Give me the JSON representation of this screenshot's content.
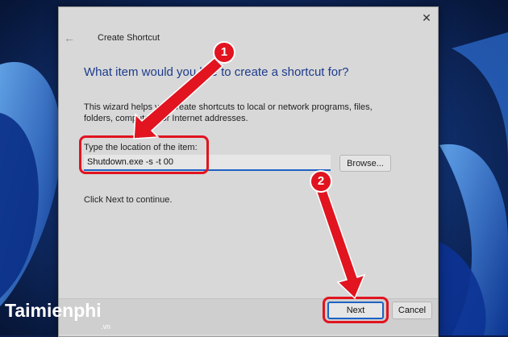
{
  "dialog": {
    "title": "Create Shortcut",
    "back_icon": "back-arrow-icon",
    "close_icon": "close-icon",
    "close_glyph": "✕",
    "back_glyph": "←",
    "heading": "What item would you like to create a shortcut for?",
    "description": "This wizard helps you create shortcuts to local or network programs, files, folders, computers, or Internet addresses.",
    "field_label": "Type the location of the item:",
    "location_value": "Shutdown.exe -s -t 00",
    "browse_label": "Browse...",
    "continue_text": "Click Next to continue.",
    "next_label": "Next",
    "cancel_label": "Cancel"
  },
  "annotations": {
    "badge_1": "1",
    "badge_2": "2",
    "highlight_color": "#e1141f"
  },
  "watermark": {
    "brand": "Taimienphi",
    "suffix": ".vn"
  },
  "colors": {
    "accent": "#1e62c4",
    "heading": "#1d3b8c",
    "annotation_red": "#e1141f"
  }
}
